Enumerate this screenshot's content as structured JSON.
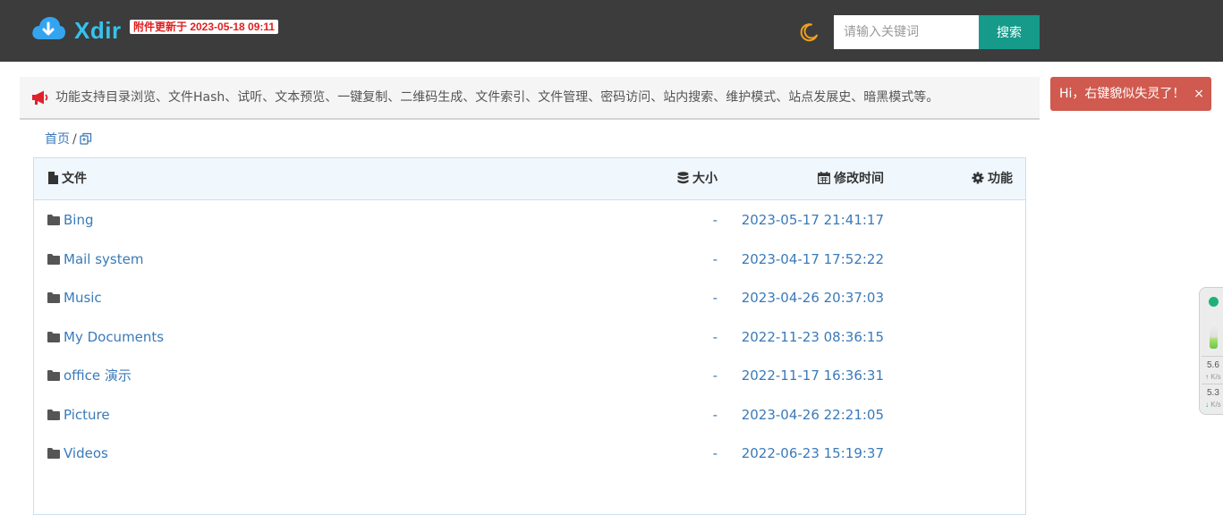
{
  "header": {
    "brand": "Xdir",
    "update_badge": "附件更新于 2023-05-18 09:11",
    "search_placeholder": "请输入关键词",
    "search_button": "搜索"
  },
  "notice": {
    "text": "功能支持目录浏览、文件Hash、试听、文本预览、一键复制、二维码生成、文件索引、文件管理、密码访问、站内搜索、维护模式、站点发展史、暗黑模式等。"
  },
  "toast": {
    "text": "Hi，右键貌似失灵了！",
    "close": "×"
  },
  "breadcrumb": {
    "home": "首页",
    "separator": "/"
  },
  "table": {
    "headers": {
      "name": "文件",
      "size": "大小",
      "time": "修改时间",
      "action": "功能"
    },
    "rows": [
      {
        "name": "Bing",
        "size": "-",
        "time": "2023-05-17 21:41:17"
      },
      {
        "name": "Mail system",
        "size": "-",
        "time": "2023-04-17 17:52:22"
      },
      {
        "name": "Music",
        "size": "-",
        "time": "2023-04-26 20:37:03"
      },
      {
        "name": "My Documents",
        "size": "-",
        "time": "2022-11-23 08:36:15"
      },
      {
        "name": "office 演示",
        "size": "-",
        "time": "2022-11-17 16:36:31"
      },
      {
        "name": "Picture",
        "size": "-",
        "time": "2023-04-26 22:21:05"
      },
      {
        "name": "Videos",
        "size": "-",
        "time": "2022-06-23 15:19:37"
      }
    ]
  },
  "net_widget": {
    "upload_value": "5.6",
    "upload_unit": "K/s",
    "download_value": "5.3",
    "download_unit": "K/s"
  },
  "colors": {
    "header_bg": "#3c3c3c",
    "brand": "#34c3ee",
    "search_button": "#169a8a",
    "link": "#3a7ab8",
    "toast_bg": "#d05a4f",
    "badge_text": "#e02020",
    "moon": "#f0a020"
  }
}
